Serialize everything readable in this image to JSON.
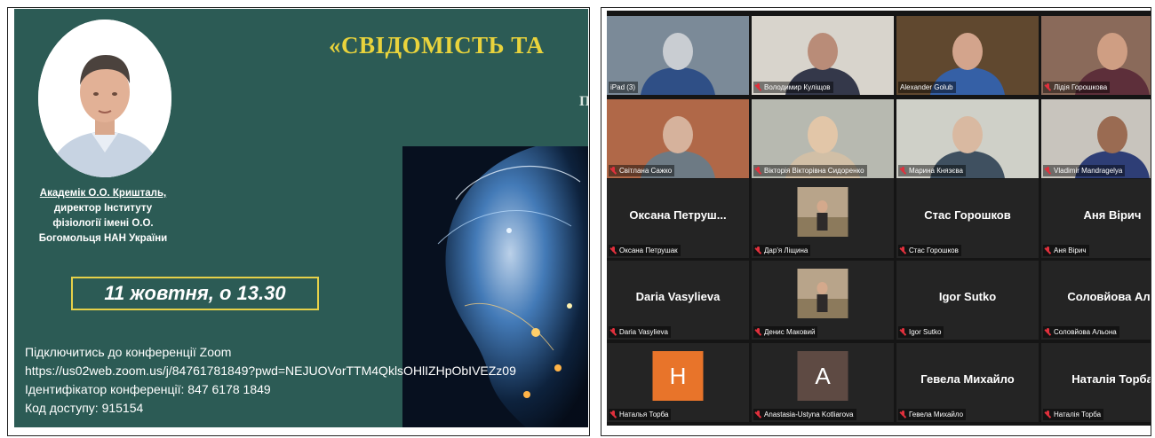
{
  "poster": {
    "title": "«СВІДОМІСТЬ ТА",
    "subtitle": "П",
    "speaker": {
      "name": "Академік О.О. Кришталь,",
      "line1": "директор Інституту",
      "line2": "фізіології імені О.О.",
      "line3": "Богомольця НАН України"
    },
    "date": "11 жовтня, о 13.30",
    "zoom": {
      "connect": "Підключитись до конференції Zoom",
      "url": "https://us02web.zoom.us/j/84761781849?pwd=NEJUOVorTTM4QklsOHlIZHpObIVEZz09",
      "meeting_id": " Ідентифікатор конференції: 847 6178 1849",
      "passcode": "Код доступу: 915154"
    }
  },
  "zoom_gallery": {
    "colors": {
      "active_speaker_border": "#c7e34a",
      "muted_icon": "#e0303c",
      "tile_bg": "#242424"
    },
    "tiles": [
      {
        "label": "iPad (3)",
        "muted": false
      },
      {
        "label": "Володимир Куліщов",
        "muted": true
      },
      {
        "label": "Alexander Golub",
        "muted": false,
        "active": true
      },
      {
        "label": "Лідія Горошкова",
        "muted": true
      },
      {
        "label": "Світлана Сажко",
        "muted": true
      },
      {
        "label": "Вікторія Вікторівна Сидоренко",
        "muted": true
      },
      {
        "label": "Марина Князєва",
        "muted": true
      },
      {
        "label": "Vladimir Mandragelya",
        "muted": true
      },
      {
        "display_name": "Оксана  Петруш...",
        "label": "Оксана Петрушак",
        "muted": true
      },
      {
        "label": "Дар'я Ліщина",
        "muted": true
      },
      {
        "display_name": "Стас Горошков",
        "label": "Стас Горошков",
        "muted": true
      },
      {
        "display_name": "Аня Вірич",
        "label": "Аня Вірич",
        "muted": true
      },
      {
        "display_name": "Daria Vasylieva",
        "label": "Daria Vasylieva",
        "muted": true
      },
      {
        "label": "Денис Маковий",
        "muted": true
      },
      {
        "display_name": "Igor Sutko",
        "label": "Igor Sutko",
        "muted": true
      },
      {
        "display_name": "Соловйова  Аль",
        "label": "Соловйова Альона",
        "muted": true
      },
      {
        "avatar_letter": "H",
        "avatar_color": "#e8742a",
        "label": "Наталья Торба",
        "muted": true
      },
      {
        "avatar_letter": "A",
        "avatar_color": "#5e4a43",
        "label": "Anastasia-Ustyna Kotliarova",
        "muted": true
      },
      {
        "display_name": "Гевела Михайло",
        "label": "Гевела Михайло",
        "muted": true
      },
      {
        "display_name": "Наталія Торба",
        "label": "Наталія Торба",
        "muted": true
      }
    ]
  }
}
